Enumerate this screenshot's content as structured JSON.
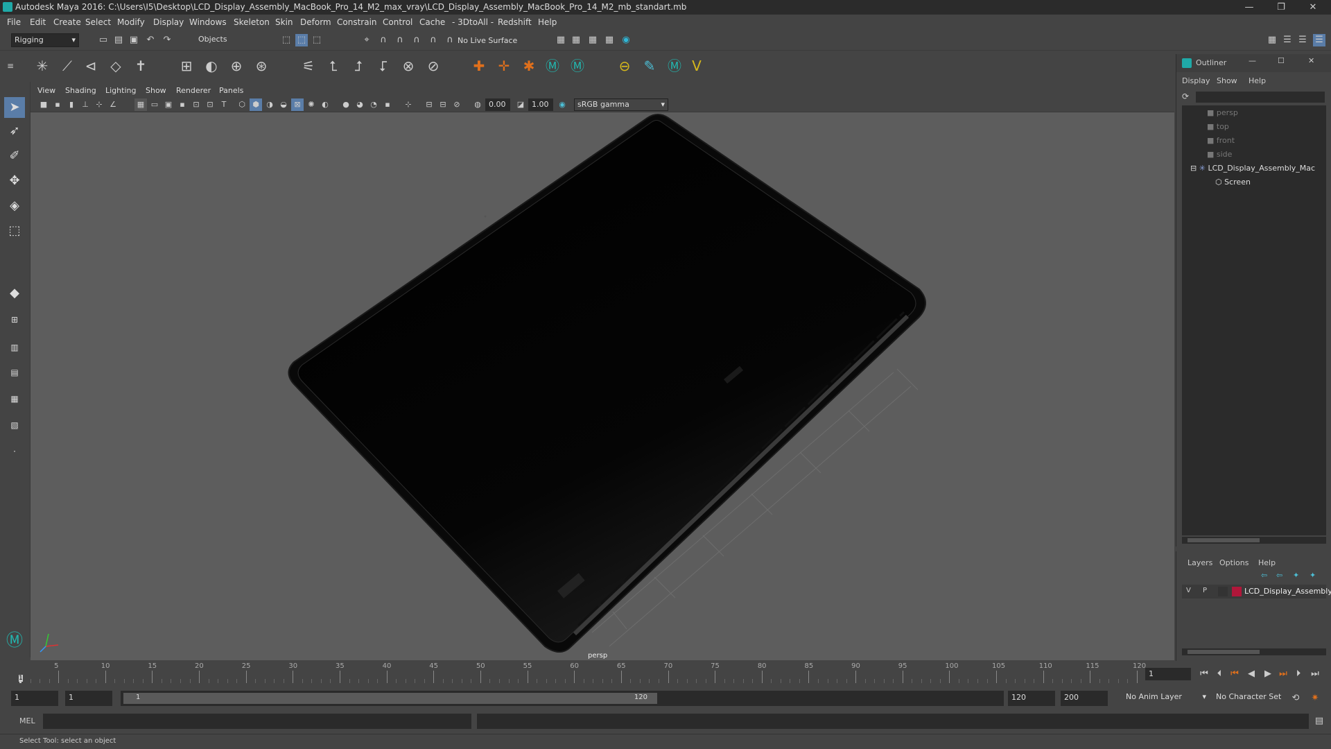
{
  "window": {
    "title": "Autodesk Maya 2016: C:\\Users\\I5\\Desktop\\LCD_Display_Assembly_MacBook_Pro_14_M2_max_vray\\LCD_Display_Assembly_MacBook_Pro_14_M2_mb_standart.mb",
    "minimize": "—",
    "restore": "❐",
    "close": "✕"
  },
  "menu": [
    "File",
    "Edit",
    "Create",
    "Select",
    "Modify",
    "Display",
    "Windows",
    "Skeleton",
    "Skin",
    "Deform",
    "Constrain",
    "Control",
    "Cache",
    "- 3DtoAll -",
    "Redshift",
    "Help"
  ],
  "statusline": {
    "mode": "Rigging",
    "selection_mask": "Objects",
    "live_surface": "No Live Surface"
  },
  "viewport": {
    "menu": [
      "View",
      "Shading",
      "Lighting",
      "Show",
      "Renderer",
      "Panels"
    ],
    "exposure": "0.00",
    "gamma": "1.00",
    "colorspace": "sRGB gamma",
    "camera_label": "persp"
  },
  "outliner": {
    "title": "Outliner",
    "menu": [
      "Display",
      "Show",
      "Help"
    ],
    "items": [
      {
        "label": "persp",
        "dim": true
      },
      {
        "label": "top",
        "dim": true
      },
      {
        "label": "front",
        "dim": true
      },
      {
        "label": "side",
        "dim": true
      },
      {
        "label": "LCD_Display_Assembly_Mac",
        "dim": false
      },
      {
        "label": "Screen",
        "dim": false
      }
    ]
  },
  "layers": {
    "menu": [
      "Layers",
      "Options",
      "Help"
    ],
    "row": {
      "v": "V",
      "p": "P",
      "name": "LCD_Display_Assembly",
      "color": "#b0173a"
    }
  },
  "timeslider": {
    "ticks": [
      "5",
      "10",
      "15",
      "20",
      "25",
      "30",
      "35",
      "40",
      "45",
      "50",
      "55",
      "60",
      "65",
      "70",
      "75",
      "80",
      "85",
      "90",
      "95",
      "100",
      "105",
      "110",
      "115",
      "120"
    ],
    "current_frame": "1",
    "current_field": "1"
  },
  "range": {
    "start": "1",
    "start2": "1",
    "slider_start": "1",
    "slider_end": "120",
    "end": "120",
    "end2": "200",
    "anim_layer": "No Anim Layer",
    "char_set": "No Character Set"
  },
  "cmdline": {
    "label": "MEL"
  },
  "helpline": {
    "text": "Select Tool: select an object"
  }
}
